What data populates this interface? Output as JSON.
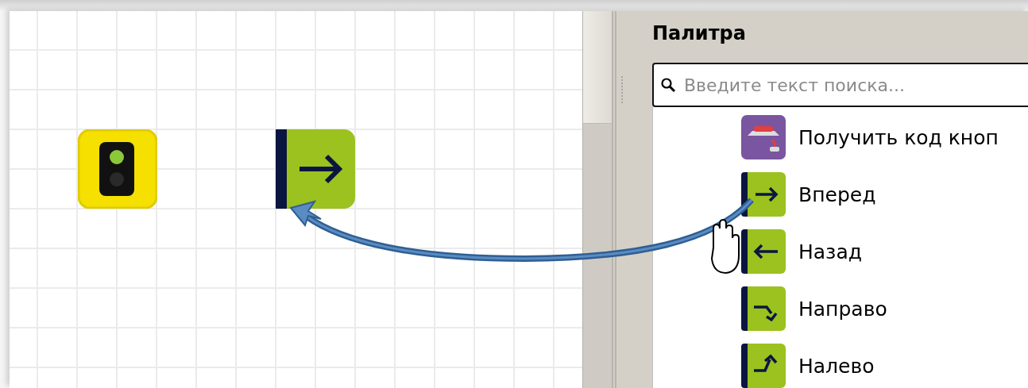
{
  "canvas": {
    "blocks": [
      {
        "kind": "traffic-light"
      },
      {
        "kind": "forward"
      }
    ]
  },
  "palette": {
    "title": "Палитра",
    "search": {
      "placeholder": "Введите текст поиска..."
    },
    "items": [
      {
        "kind": "button-code",
        "label": "Получить код кноп"
      },
      {
        "kind": "forward",
        "label": "Вперед"
      },
      {
        "kind": "back",
        "label": "Назад"
      },
      {
        "kind": "right",
        "label": "Направо"
      },
      {
        "kind": "left",
        "label": "Налево"
      }
    ]
  }
}
